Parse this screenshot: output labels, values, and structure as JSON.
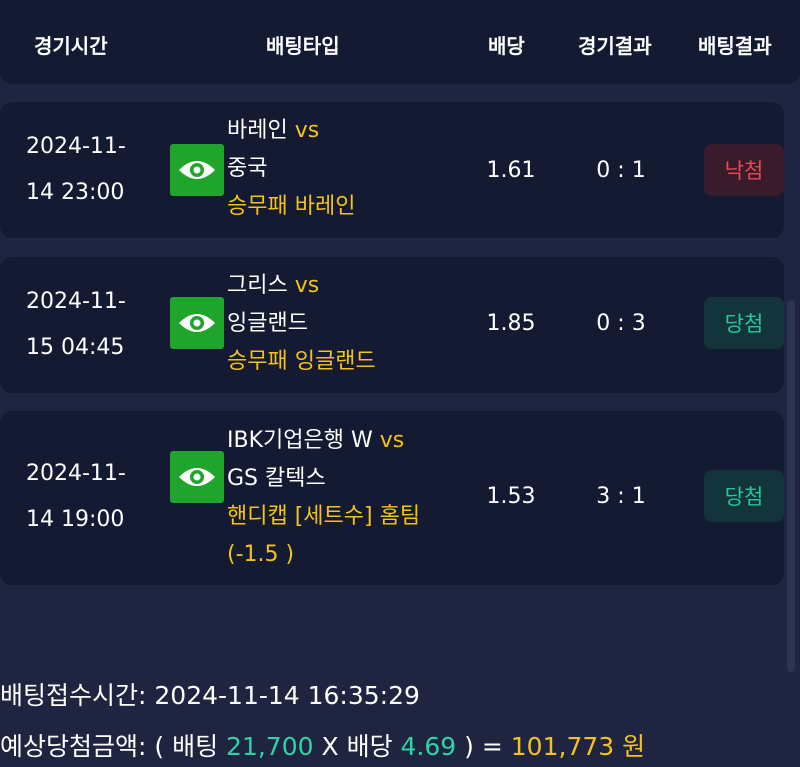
{
  "header": {
    "col_time": "경기시간",
    "col_bet_type": "배팅타입",
    "col_odds": "배당",
    "col_result": "경기결과",
    "col_bet_result": "배팅결과"
  },
  "bets": [
    {
      "time": "2024-11-14 23:00",
      "home": "바레인",
      "vs": "vs",
      "away": "중국",
      "pick": "승무패 바레인",
      "pick_extra": "",
      "odds": "1.61",
      "score": "0 : 1",
      "result": "낙첨"
    },
    {
      "time": "2024-11-15 04:45",
      "home": "그리스",
      "vs": "vs",
      "away": "잉글랜드",
      "pick": "승무패 잉글랜드",
      "pick_extra": "",
      "odds": "1.85",
      "score": "0 : 3",
      "result": "당첨"
    },
    {
      "time": "2024-11-14 19:00",
      "home": "IBK기업은행 W",
      "vs": "vs",
      "away": "GS 칼텍스",
      "pick": "핸디캡 [세트수] 홈팀",
      "pick_extra": "(-1.5 )",
      "odds": "1.53",
      "score": "3 : 1",
      "result": "당첨"
    }
  ],
  "footer": {
    "accept_label": "배팅접수시간:",
    "accept_time": "2024-11-14 16:35:29",
    "expected_label": "예상당첨금액: (",
    "bet_word": "배팅",
    "bet_amount": "21,700",
    "multiply": "X",
    "odds_word": "배당",
    "total_odds": "4.69",
    "equals": ") =",
    "payout": "101,773 원"
  },
  "colors": {
    "background": "#1f2540",
    "card": "#141a31",
    "eye_button": "#1fa52b",
    "accent_yellow": "#f4c21b",
    "win": "#22c9a0",
    "lose": "#e64a55"
  },
  "icons": {
    "detail": "eye-icon"
  }
}
